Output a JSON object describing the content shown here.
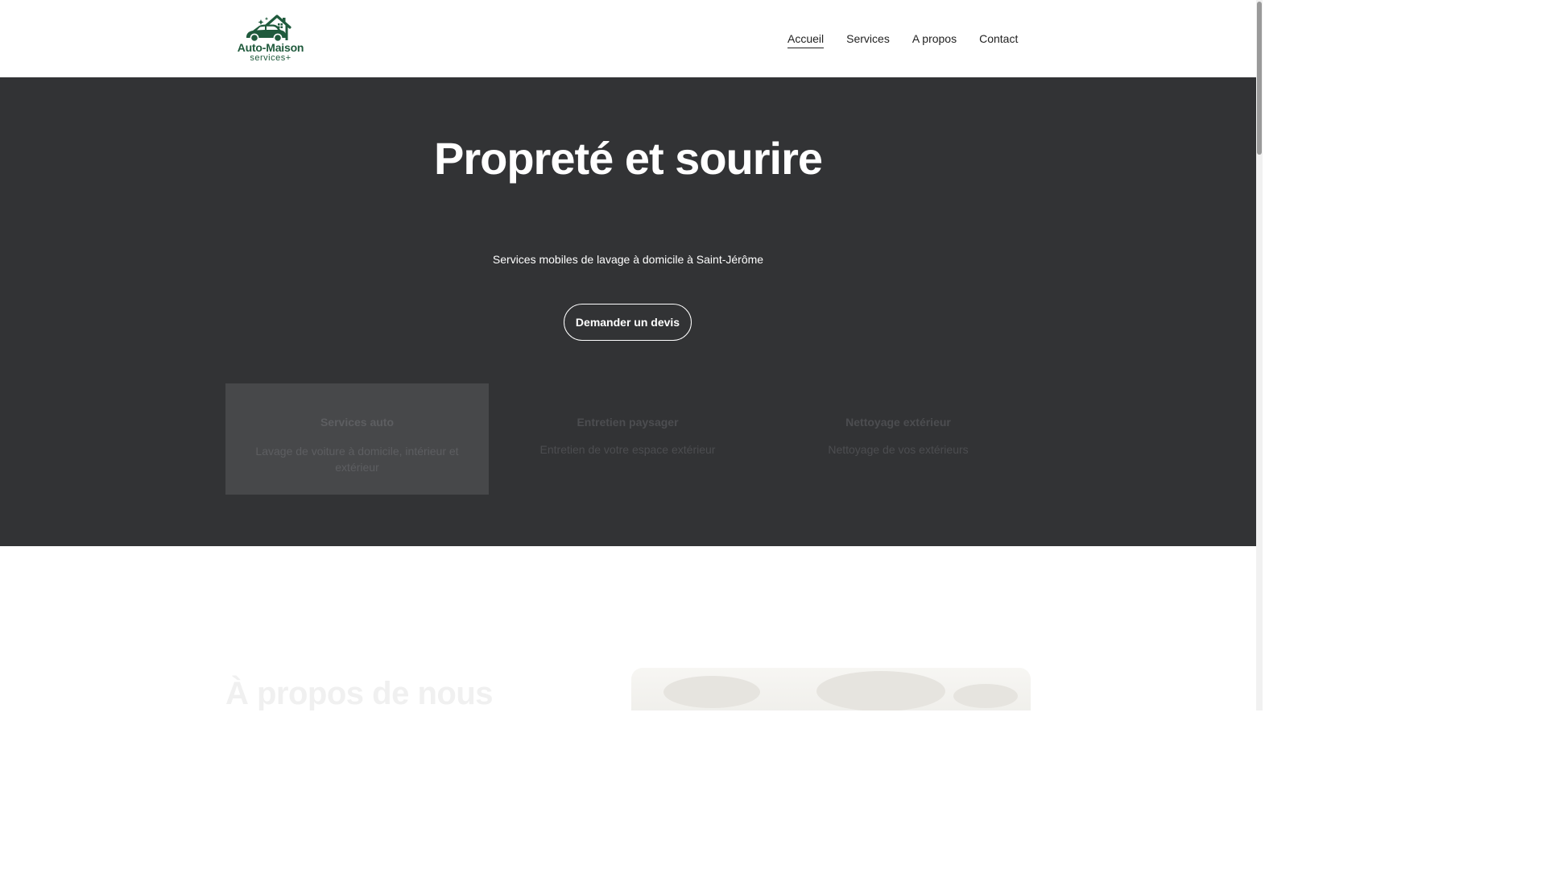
{
  "header": {
    "logo": {
      "title": "Auto-Maison",
      "subtitle": "services+",
      "icon": "car-house-logo-icon",
      "color": "#1f5a3c"
    },
    "nav": [
      {
        "label": "Accueil",
        "active": true
      },
      {
        "label": "Services",
        "active": false
      },
      {
        "label": "A propos",
        "active": false
      },
      {
        "label": "Contact",
        "active": false
      }
    ]
  },
  "hero": {
    "title": "Propreté et sourire",
    "subtitle": "Services mobiles de lavage à domicile à Saint-Jérôme",
    "cta_label": "Demander un devis",
    "background_color": "#323335",
    "cards": [
      {
        "title": "Services auto",
        "description": "Lavage de voiture à domicile, intérieur et extérieur"
      },
      {
        "title": "Entretien paysager",
        "description": "Entretien de votre espace extérieur"
      },
      {
        "title": "Nettoyage extérieur",
        "description": "Nettoyage de vos extérieurs"
      }
    ]
  },
  "about": {
    "title": "À propos de nous"
  }
}
